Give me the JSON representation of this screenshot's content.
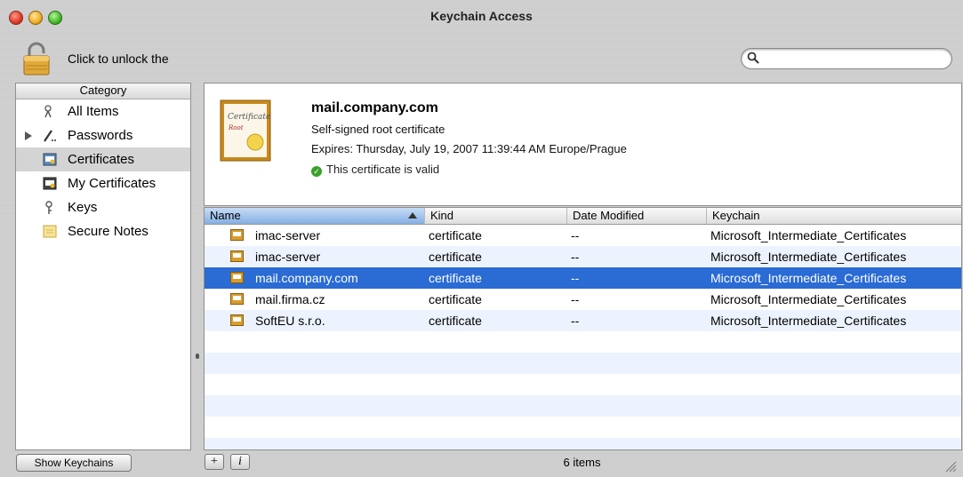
{
  "window": {
    "title": "Keychain Access"
  },
  "toolbar": {
    "lock_label": "Click to unlock the",
    "search_placeholder": ""
  },
  "sidebar": {
    "header": "Category",
    "items": [
      {
        "label": "All Items",
        "icon": "key-ring-icon"
      },
      {
        "label": "Passwords",
        "icon": "pen-icon"
      },
      {
        "label": "Certificates",
        "icon": "certificate-icon"
      },
      {
        "label": "My Certificates",
        "icon": "my-certificate-icon"
      },
      {
        "label": "Keys",
        "icon": "key-icon"
      },
      {
        "label": "Secure Notes",
        "icon": "note-icon"
      }
    ],
    "selected": "Certificates",
    "show_keychains": "Show Keychains"
  },
  "detail": {
    "name": "mail.company.com",
    "type": "Self-signed root certificate",
    "expires": "Expires: Thursday, July 19, 2007 11:39:44 AM Europe/Prague",
    "status": "This certificate is valid",
    "image_text": "Certificate",
    "image_subtext": "Root"
  },
  "table": {
    "columns": [
      "Name",
      "Kind",
      "Date Modified",
      "Keychain"
    ],
    "sorted_by": "Name",
    "rows": [
      {
        "name": "imac-server",
        "kind": "certificate",
        "date": "--",
        "keychain": "Microsoft_Intermediate_Certificates"
      },
      {
        "name": "imac-server",
        "kind": "certificate",
        "date": "--",
        "keychain": "Microsoft_Intermediate_Certificates"
      },
      {
        "name": "mail.company.com",
        "kind": "certificate",
        "date": "--",
        "keychain": "Microsoft_Intermediate_Certificates"
      },
      {
        "name": "mail.firma.cz",
        "kind": "certificate",
        "date": "--",
        "keychain": "Microsoft_Intermediate_Certificates"
      },
      {
        "name": "SoftEU s.r.o.",
        "kind": "certificate",
        "date": "--",
        "keychain": "Microsoft_Intermediate_Certificates"
      }
    ],
    "selected_row": 2
  },
  "footer": {
    "count": "6 items",
    "add_label": "+",
    "info_label": "i"
  },
  "colors": {
    "selection": "#2a6bd4",
    "stripe": "#edf3fe",
    "valid": "#39a12b"
  }
}
